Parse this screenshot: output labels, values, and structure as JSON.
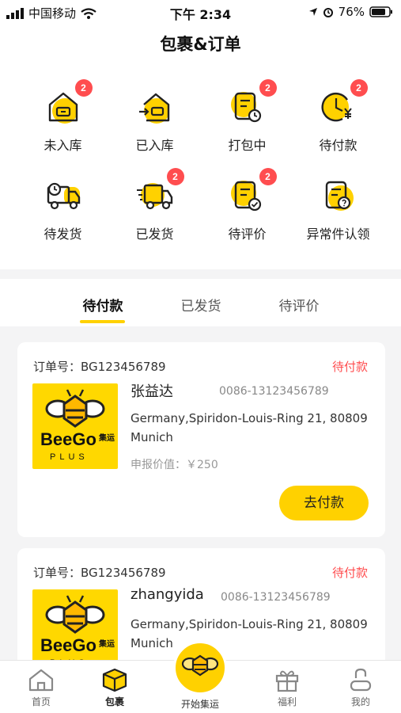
{
  "status_bar": {
    "carrier": "中国移动",
    "time": "下午 2:34",
    "battery": "76%"
  },
  "header": {
    "title": "包裹&订单"
  },
  "grid": [
    {
      "label": "未入库",
      "badge": "2",
      "icon": "house-box-icon"
    },
    {
      "label": "已入库",
      "badge": "",
      "icon": "house-arrow-icon"
    },
    {
      "label": "打包中",
      "badge": "2",
      "icon": "pack-clock-icon"
    },
    {
      "label": "待付款",
      "badge": "2",
      "icon": "yen-clock-icon"
    },
    {
      "label": "待发货",
      "badge": "",
      "icon": "truck-clock-icon"
    },
    {
      "label": "已发货",
      "badge": "2",
      "icon": "truck-moving-icon"
    },
    {
      "label": "待评价",
      "badge": "2",
      "icon": "review-check-icon"
    },
    {
      "label": "异常件认领",
      "badge": "",
      "icon": "question-doc-icon"
    }
  ],
  "tabs": [
    {
      "label": "待付款",
      "active": true
    },
    {
      "label": "已发货",
      "active": false
    },
    {
      "label": "待评价",
      "active": false
    }
  ],
  "orders": [
    {
      "order_no": "订单号：BG123456789",
      "status": "待付款",
      "name": "张益达",
      "phone": "0086-13123456789",
      "address": "Germany,Spiridon-Louis-Ring 21, 80809 Munich",
      "value": "申报价值：￥250",
      "button": "去付款"
    },
    {
      "order_no": "订单号：BG123456789",
      "status": "待付款",
      "name": "zhangyida",
      "phone": "0086-13123456789",
      "address": "Germany,Spiridon-Louis-Ring 21, 80809 Munich"
    }
  ],
  "logo": {
    "brand": "BeeGo",
    "sub": "PLUS",
    "cn": "集运"
  },
  "bottom_nav": {
    "home": "首页",
    "parcel": "包裹",
    "center": "开始集运",
    "benefit": "福利",
    "mine": "我的"
  },
  "colors": {
    "accent": "#ffd100",
    "alert": "#ff4d4f"
  }
}
